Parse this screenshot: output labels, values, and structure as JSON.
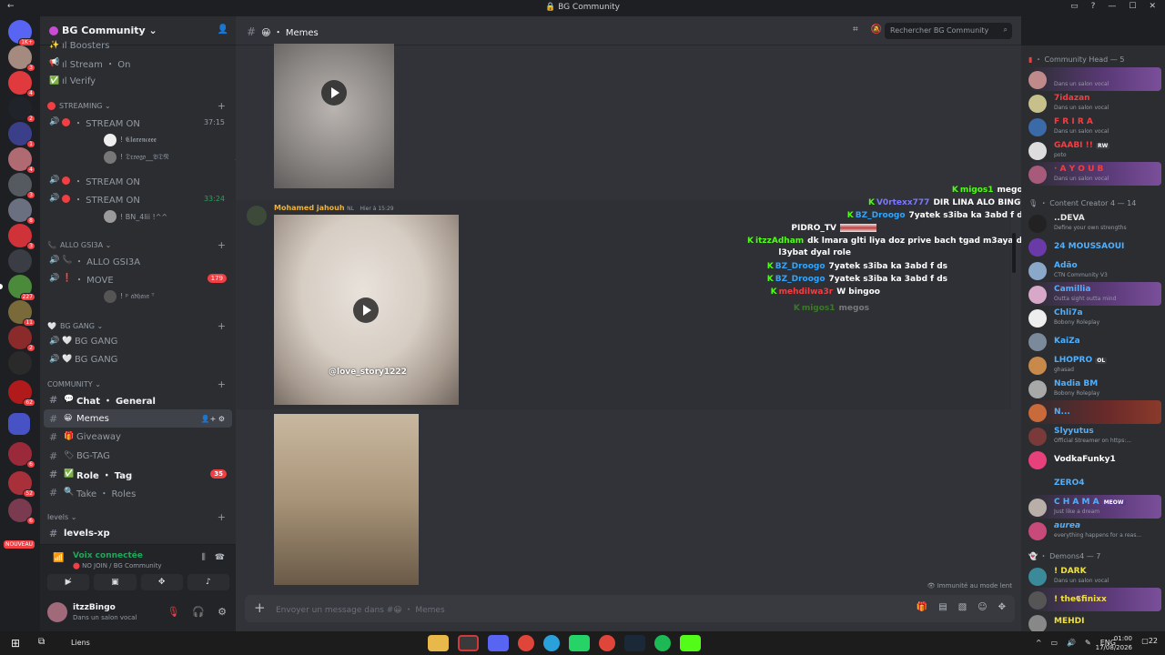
{
  "window": {
    "title": "BG Community"
  },
  "guilds": {
    "badges": [
      "1K+",
      "3",
      "4",
      "2",
      "1",
      "4",
      "3",
      "8",
      "3",
      "227",
      "11",
      "2",
      "62",
      "6",
      "52",
      "6"
    ],
    "new_label": "NOUVEAU"
  },
  "server": {
    "name": "BG Community"
  },
  "channels": {
    "top": [
      {
        "emoji": "✨",
        "label": "ıl Boosters"
      },
      {
        "emoji": "📢",
        "label": "ıl Stream ・ On"
      },
      {
        "emoji": "✅",
        "label": "ıl Verify"
      }
    ],
    "streaming_cat": "STREAMING",
    "stream1": {
      "label": "・ STREAM ON",
      "time": "37:15"
    },
    "stream1_users": [
      "! 𝕮𝖑𝖆𝖗𝖊𝖓𝖈𝖊𝖊𝖊",
      "! 𝔇𝔯𝔬𝔬𝔤𝔬__𝔅𝔇𝔑"
    ],
    "stream2": {
      "label": "・ STREAM ON"
    },
    "stream3": {
      "label": "・ STREAM ON",
      "time": "33:24"
    },
    "stream3_users": [
      "! BN_4lii !^^"
    ],
    "allo_cat": "ALLO GSI3A",
    "allo": {
      "label": "・ ALLO GSI3A"
    },
    "move": {
      "label": "・ MOVE",
      "count": "179"
    },
    "move_users": [
      "! ᵖ 𝔞𝔡𝔥𝔞𝔪 ᵀ"
    ],
    "bggang_cat": "BG GANG",
    "bggang1": "BG GANG",
    "bggang2": "BG GANG",
    "community_cat": "COMMUNITY",
    "chat": "Chat ・ General",
    "memes": "Memes",
    "giveaway": "Giveaway",
    "bgtag": "BG-TAG",
    "role": "Role ・ Tag",
    "role_count": "35",
    "take": "Take ・ Roles",
    "levels_cat": "levels",
    "levelsxp": "levels-xp"
  },
  "voice": {
    "connected": "Voix connectée",
    "where": "NO JOIN / BG Community"
  },
  "user": {
    "name": "itzzBingo",
    "status": "Dans un salon vocal"
  },
  "channel_header": {
    "name": "Memes",
    "emoji": "😀"
  },
  "search": {
    "placeholder": "Rechercher BG Community"
  },
  "message": {
    "author": "Mohamed jahouh",
    "tag": "NL",
    "time": "Hier à 15:29"
  },
  "video": {
    "watermark": "@love_story1222"
  },
  "overlay_chat": [
    {
      "user": "migos1",
      "text": "megos",
      "color": "#53fc18"
    },
    {
      "user": "V0rtexx777",
      "text": "DIR LINA ALO BINGO",
      "color": "#7b78ff"
    },
    {
      "user": "BZ_Droogo",
      "text": "7yatek s3iba ka 3abd f ds",
      "color": "#2fa5ff"
    },
    {
      "user": "PIDRO_TV",
      "text": "",
      "color": "#ffffff"
    },
    {
      "user": "itzzAdham",
      "text": "dk lmara glti liya doz prive bach tgad m3aya dk",
      "color": "#53fc18"
    },
    {
      "user": "",
      "text": "l3ybat dyal role",
      "color": "#ffffff"
    },
    {
      "user": "BZ_Droogo",
      "text": "7yatek s3iba ka 3abd f ds",
      "color": "#2fa5ff"
    },
    {
      "user": "BZ_Droogo",
      "text": "7yatek s3iba ka 3abd f ds",
      "color": "#2fa5ff"
    },
    {
      "user": "mehdilwa3r",
      "text": "W bingoo",
      "color": "#f23f43"
    },
    {
      "user": "migos1",
      "text": "megos",
      "color": "#2f6b3f"
    }
  ],
  "slow_mode": "Immunité au mode lent",
  "composer": {
    "placeholder": "Envoyer un message dans #😀 ・ Memes"
  },
  "members": {
    "cat1": "Community Head — 5",
    "cat2": "Content Creator 4 — 14",
    "cat3": "Demons4 — 7",
    "head": [
      {
        "name": "",
        "status": "Dans un salon vocal",
        "color": "#e6e6e6"
      },
      {
        "name": "7idazan",
        "status": "Dans un salon vocal",
        "color": "#f23f43"
      },
      {
        "name": "F R I R A",
        "status": "Dans un salon vocal",
        "color": "#f23f43"
      },
      {
        "name": "GAABI !!",
        "badge": "RW",
        "status": "poto",
        "color": "#f23f43"
      },
      {
        "name": "· A Y O U B",
        "status": "Dans un salon vocal",
        "color": "#f23f43"
      }
    ],
    "creators": [
      {
        "name": "..DEVA",
        "status": "Define your own strengths",
        "color": "#e6e6e6"
      },
      {
        "name": "24 MOUSSAOUI",
        "status": "",
        "color": "#4fb0ff"
      },
      {
        "name": "Adão",
        "status": "CTN Community V3",
        "color": "#4fb0ff"
      },
      {
        "name": "Camillia",
        "status": "Outta sight outta mind",
        "color": "#4fb0ff"
      },
      {
        "name": "Chli7a",
        "status": "Bobony Roleplay",
        "color": "#4fb0ff"
      },
      {
        "name": "KaiZa",
        "status": "",
        "color": "#4fb0ff"
      },
      {
        "name": "LHOPRO",
        "badge": "OL",
        "status": "ghasad",
        "color": "#4fb0ff"
      },
      {
        "name": "Nadia BM",
        "status": "Bobony Roleplay",
        "color": "#4fb0ff"
      },
      {
        "name": "N...",
        "status": "",
        "color": "#4fb0ff"
      },
      {
        "name": "Slyyutus",
        "status": "Official Streamer on https:...",
        "color": "#4fb0ff"
      },
      {
        "name": "VodkaFunky1",
        "status": "",
        "color": "#ffffff"
      },
      {
        "name": "ZERO4",
        "status": "",
        "color": "#4fb0ff"
      },
      {
        "name": "C H A M A",
        "badge": "MEOW",
        "status": "Just like a dream",
        "color": "#4fb0ff"
      },
      {
        "name": "aurea",
        "status": "everything happens for a reas...",
        "color": "#4fb0ff"
      }
    ],
    "demons": [
      {
        "name": "! DARK",
        "status": "Dans un salon vocal",
        "color": "#f0e040"
      },
      {
        "name": "! the𝕮finixx",
        "status": "",
        "color": "#f0e040"
      },
      {
        "name": "MEHDI",
        "status": "",
        "color": "#f0e040"
      }
    ]
  },
  "taskbar": {
    "links": "Liens",
    "lang": "ENG",
    "time": "01:00",
    "date": "17/08/2026",
    "notif": "22"
  }
}
